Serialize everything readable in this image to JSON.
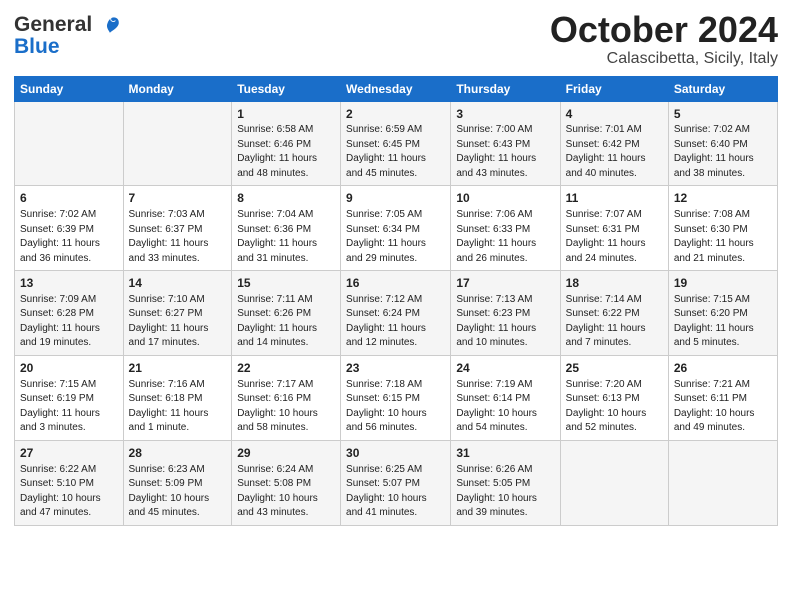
{
  "logo": {
    "line1": "General",
    "line2": "Blue"
  },
  "header": {
    "month": "October 2024",
    "location": "Calascibetta, Sicily, Italy"
  },
  "weekdays": [
    "Sunday",
    "Monday",
    "Tuesday",
    "Wednesday",
    "Thursday",
    "Friday",
    "Saturday"
  ],
  "weeks": [
    [
      {
        "day": "",
        "info": ""
      },
      {
        "day": "",
        "info": ""
      },
      {
        "day": "1",
        "info": "Sunrise: 6:58 AM\nSunset: 6:46 PM\nDaylight: 11 hours and 48 minutes."
      },
      {
        "day": "2",
        "info": "Sunrise: 6:59 AM\nSunset: 6:45 PM\nDaylight: 11 hours and 45 minutes."
      },
      {
        "day": "3",
        "info": "Sunrise: 7:00 AM\nSunset: 6:43 PM\nDaylight: 11 hours and 43 minutes."
      },
      {
        "day": "4",
        "info": "Sunrise: 7:01 AM\nSunset: 6:42 PM\nDaylight: 11 hours and 40 minutes."
      },
      {
        "day": "5",
        "info": "Sunrise: 7:02 AM\nSunset: 6:40 PM\nDaylight: 11 hours and 38 minutes."
      }
    ],
    [
      {
        "day": "6",
        "info": "Sunrise: 7:02 AM\nSunset: 6:39 PM\nDaylight: 11 hours and 36 minutes."
      },
      {
        "day": "7",
        "info": "Sunrise: 7:03 AM\nSunset: 6:37 PM\nDaylight: 11 hours and 33 minutes."
      },
      {
        "day": "8",
        "info": "Sunrise: 7:04 AM\nSunset: 6:36 PM\nDaylight: 11 hours and 31 minutes."
      },
      {
        "day": "9",
        "info": "Sunrise: 7:05 AM\nSunset: 6:34 PM\nDaylight: 11 hours and 29 minutes."
      },
      {
        "day": "10",
        "info": "Sunrise: 7:06 AM\nSunset: 6:33 PM\nDaylight: 11 hours and 26 minutes."
      },
      {
        "day": "11",
        "info": "Sunrise: 7:07 AM\nSunset: 6:31 PM\nDaylight: 11 hours and 24 minutes."
      },
      {
        "day": "12",
        "info": "Sunrise: 7:08 AM\nSunset: 6:30 PM\nDaylight: 11 hours and 21 minutes."
      }
    ],
    [
      {
        "day": "13",
        "info": "Sunrise: 7:09 AM\nSunset: 6:28 PM\nDaylight: 11 hours and 19 minutes."
      },
      {
        "day": "14",
        "info": "Sunrise: 7:10 AM\nSunset: 6:27 PM\nDaylight: 11 hours and 17 minutes."
      },
      {
        "day": "15",
        "info": "Sunrise: 7:11 AM\nSunset: 6:26 PM\nDaylight: 11 hours and 14 minutes."
      },
      {
        "day": "16",
        "info": "Sunrise: 7:12 AM\nSunset: 6:24 PM\nDaylight: 11 hours and 12 minutes."
      },
      {
        "day": "17",
        "info": "Sunrise: 7:13 AM\nSunset: 6:23 PM\nDaylight: 11 hours and 10 minutes."
      },
      {
        "day": "18",
        "info": "Sunrise: 7:14 AM\nSunset: 6:22 PM\nDaylight: 11 hours and 7 minutes."
      },
      {
        "day": "19",
        "info": "Sunrise: 7:15 AM\nSunset: 6:20 PM\nDaylight: 11 hours and 5 minutes."
      }
    ],
    [
      {
        "day": "20",
        "info": "Sunrise: 7:15 AM\nSunset: 6:19 PM\nDaylight: 11 hours and 3 minutes."
      },
      {
        "day": "21",
        "info": "Sunrise: 7:16 AM\nSunset: 6:18 PM\nDaylight: 11 hours and 1 minute."
      },
      {
        "day": "22",
        "info": "Sunrise: 7:17 AM\nSunset: 6:16 PM\nDaylight: 10 hours and 58 minutes."
      },
      {
        "day": "23",
        "info": "Sunrise: 7:18 AM\nSunset: 6:15 PM\nDaylight: 10 hours and 56 minutes."
      },
      {
        "day": "24",
        "info": "Sunrise: 7:19 AM\nSunset: 6:14 PM\nDaylight: 10 hours and 54 minutes."
      },
      {
        "day": "25",
        "info": "Sunrise: 7:20 AM\nSunset: 6:13 PM\nDaylight: 10 hours and 52 minutes."
      },
      {
        "day": "26",
        "info": "Sunrise: 7:21 AM\nSunset: 6:11 PM\nDaylight: 10 hours and 49 minutes."
      }
    ],
    [
      {
        "day": "27",
        "info": "Sunrise: 6:22 AM\nSunset: 5:10 PM\nDaylight: 10 hours and 47 minutes."
      },
      {
        "day": "28",
        "info": "Sunrise: 6:23 AM\nSunset: 5:09 PM\nDaylight: 10 hours and 45 minutes."
      },
      {
        "day": "29",
        "info": "Sunrise: 6:24 AM\nSunset: 5:08 PM\nDaylight: 10 hours and 43 minutes."
      },
      {
        "day": "30",
        "info": "Sunrise: 6:25 AM\nSunset: 5:07 PM\nDaylight: 10 hours and 41 minutes."
      },
      {
        "day": "31",
        "info": "Sunrise: 6:26 AM\nSunset: 5:05 PM\nDaylight: 10 hours and 39 minutes."
      },
      {
        "day": "",
        "info": ""
      },
      {
        "day": "",
        "info": ""
      }
    ]
  ]
}
